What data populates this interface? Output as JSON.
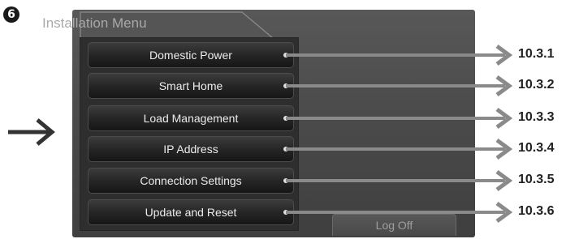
{
  "step_number": "6",
  "window": {
    "title": "Installation Menu"
  },
  "menu": {
    "items": [
      {
        "label": "Domestic Power",
        "ref": "10.3.1"
      },
      {
        "label": "Smart Home",
        "ref": "10.3.2"
      },
      {
        "label": "Load Management",
        "ref": "10.3.3"
      },
      {
        "label": "IP Address",
        "ref": "10.3.4"
      },
      {
        "label": "Connection Settings",
        "ref": "10.3.5"
      },
      {
        "label": "Update and Reset",
        "ref": "10.3.6"
      }
    ]
  },
  "logoff": {
    "label": "Log Off"
  },
  "colors": {
    "arrow": "#8a8a8a",
    "pointer_arrow": "#333333",
    "screen_bg": "#4b4b4b"
  }
}
